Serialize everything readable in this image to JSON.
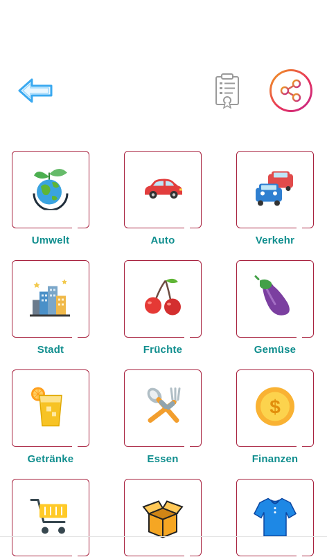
{
  "toolbar": {
    "back_icon": "arrow-left-icon",
    "document_icon": "certificate-document-icon",
    "share_icon": "share-icon",
    "colors": {
      "back": "#3aa9f0",
      "share_ring_start": "#f0a11c",
      "share_ring_end": "#c2258d"
    }
  },
  "categories": [
    {
      "label": "Umwelt",
      "icon": "earth-plant-icon"
    },
    {
      "label": "Auto",
      "icon": "car-icon"
    },
    {
      "label": "Verkehr",
      "icon": "traffic-cars-icon"
    },
    {
      "label": "Stadt",
      "icon": "city-buildings-icon"
    },
    {
      "label": "Früchte",
      "icon": "cherries-icon"
    },
    {
      "label": "Gemüse",
      "icon": "eggplant-icon"
    },
    {
      "label": "Getränke",
      "icon": "lemonade-glass-icon"
    },
    {
      "label": "Essen",
      "icon": "spoon-fork-icon"
    },
    {
      "label": "Finanzen",
      "icon": "dollar-coin-icon"
    },
    {
      "label": "",
      "icon": "shopping-cart-icon"
    },
    {
      "label": "",
      "icon": "open-box-icon"
    },
    {
      "label": "",
      "icon": "shirt-icon"
    }
  ],
  "colors": {
    "card_border": "#a8223f",
    "label": "#108e8e"
  }
}
